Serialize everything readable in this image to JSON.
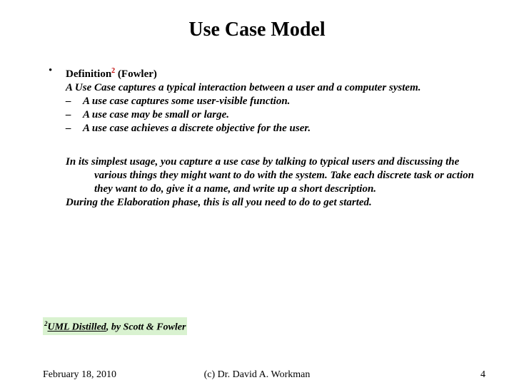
{
  "title": "Use Case Model",
  "definition": {
    "label_pre": "Definition",
    "sup": "2",
    "label_post": " (Fowler)",
    "intro": "A Use Case captures a typical interaction between a user and a computer system.",
    "points": [
      "A use case captures some user-visible function.",
      "A use case may be small or large.",
      "A use case achieves a discrete objective for the user."
    ]
  },
  "paragraphs": [
    "In its simplest usage, you capture a use case by talking to typical users and discussing the various things they might want to do with the system. Take each discrete task or action they want to do, give it a name, and write up a short description.",
    "During the Elaboration phase, this is all you need to do to get started."
  ],
  "footnote": {
    "sup": "2",
    "title": "UML Distilled",
    "rest": ", by Scott & Fowler"
  },
  "footer": {
    "date": "February 18, 2010",
    "copyright": "(c) Dr. David A. Workman",
    "page": "4"
  }
}
